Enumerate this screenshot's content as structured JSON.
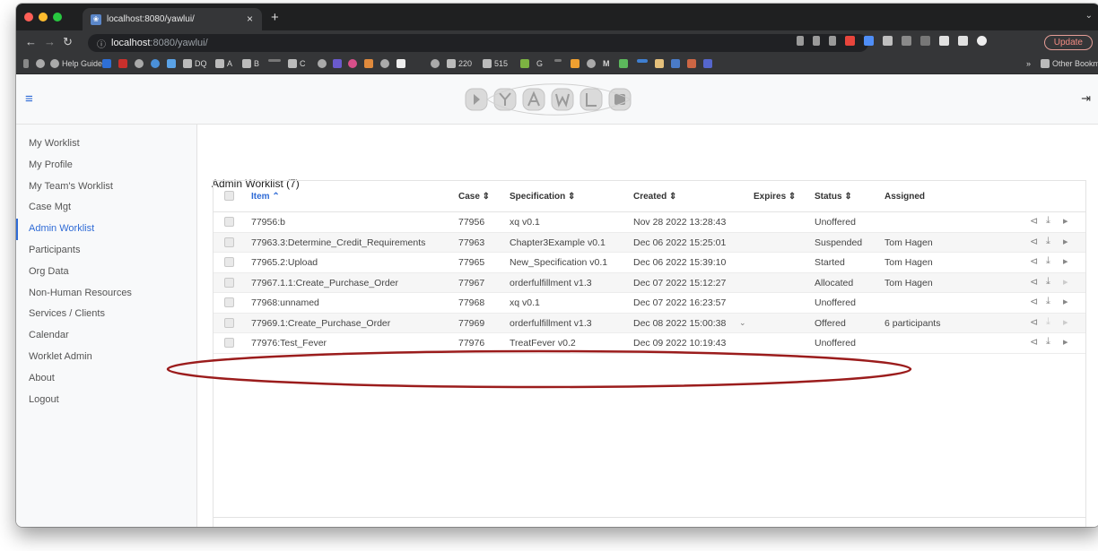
{
  "browser": {
    "tab_title": "localhost:8080/yawlui/",
    "url_host": "localhost",
    "url_path": ":8080/yawlui/",
    "update_label": "Update"
  },
  "bookmarks": {
    "help_guide": "Help Guide",
    "dq": "DQ",
    "a": "A",
    "b": "B",
    "c": "C",
    "b220": "220",
    "b515": "515",
    "g": "G",
    "m": "M",
    "other": "Other Bookmarks"
  },
  "sidebar": {
    "items": [
      {
        "label": "My Worklist"
      },
      {
        "label": "My Profile"
      },
      {
        "label": "My Team's Worklist"
      },
      {
        "label": "Case Mgt"
      },
      {
        "label": "Admin Worklist"
      },
      {
        "label": "Participants"
      },
      {
        "label": "Org Data"
      },
      {
        "label": "Non-Human Resources"
      },
      {
        "label": "Services / Clients"
      },
      {
        "label": "Calendar"
      },
      {
        "label": "Worklet Admin"
      },
      {
        "label": "About"
      },
      {
        "label": "Logout"
      }
    ]
  },
  "main": {
    "title": "Admin Worklist (7)",
    "columns": {
      "item": "Item ⌃",
      "case": "Case ⇕",
      "spec": "Specification ⇕",
      "created": "Created ⇕",
      "expires": "Expires ⇕",
      "status": "Status ⇕",
      "assigned": "Assigned"
    },
    "rows": [
      {
        "item": "77956:b",
        "case": "77956",
        "spec": "xq v0.1",
        "created": "Nov 28 2022 13:28:43",
        "status": "Unoffered",
        "assigned": ""
      },
      {
        "item": "77963.3:Determine_Credit_Requirements",
        "case": "77963",
        "spec": "Chapter3Example v0.1",
        "created": "Dec 06 2022 15:25:01",
        "status": "Suspended",
        "assigned": "Tom Hagen"
      },
      {
        "item": "77965.2:Upload",
        "case": "77965",
        "spec": "New_Specification v0.1",
        "created": "Dec 06 2022 15:39:10",
        "status": "Started",
        "assigned": "Tom Hagen"
      },
      {
        "item": "77967.1.1:Create_Purchase_Order",
        "case": "77967",
        "spec": "orderfulfillment v1.3",
        "created": "Dec 07 2022 15:12:27",
        "status": "Allocated",
        "assigned": "Tom Hagen"
      },
      {
        "item": "77968:unnamed",
        "case": "77968",
        "spec": "xq v0.1",
        "created": "Dec 07 2022 16:23:57",
        "status": "Unoffered",
        "assigned": ""
      },
      {
        "item": "77969.1:Create_Purchase_Order",
        "case": "77969",
        "spec": "orderfulfillment v1.3",
        "created": "Dec 08 2022 15:00:38",
        "status": "Offered",
        "assigned": "6 participants"
      },
      {
        "item": "77976:Test_Fever",
        "case": "77976",
        "spec": "TreatFever v0.2",
        "created": "Dec 09 2022 10:19:43",
        "status": "Unoffered",
        "assigned": ""
      }
    ]
  },
  "icons": {
    "row_actions": [
      "reassign-icon",
      "download-icon",
      "start-icon"
    ],
    "footer": [
      "settings-icon",
      "refresh-disabled-icon",
      "refresh-icon"
    ]
  },
  "colors": {
    "accent": "#2f6bd6",
    "highlight_ellipse": "#9b1c1c"
  }
}
